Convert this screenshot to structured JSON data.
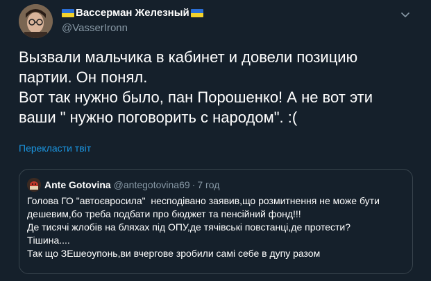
{
  "tweet": {
    "author": {
      "name": "Вассерман Железный",
      "handle": "@VasserIronn",
      "flag_colors": [
        "#2b6fd6",
        "#f3d22b"
      ]
    },
    "text": "Вызвали мальчика в кабинет и довели позицию\nпартии. Он понял.\nВот так нужно было, пан Порошенко! А не вот эти\nваши \" нужно поговорить с народом\". :(",
    "translate_label": "Перекласти твіт",
    "menu_icon": "chevron-down-icon"
  },
  "quote": {
    "name": "Ante Gotovina",
    "handle": "@antegotovina69",
    "separator": "·",
    "time": "7 год",
    "text": "Голова ГО \"автоєвросила\"  несподівано заявив,що розмитнення не може бути\nдешевим,бо треба подбати про бюджет та пенсійний фонд!!!\nДе тисячі жлобів на бляхах під ОПУ,де тячівські повстанці,де протести?\nТішина....\nТак що ЗЕшеоупонь,ви вчергове зробили самі себе в дупу разом"
  },
  "colors": {
    "background": "#15202b",
    "text": "#ffffff",
    "secondary": "#8899a6",
    "link": "#1b95e0",
    "border": "#38444d"
  }
}
